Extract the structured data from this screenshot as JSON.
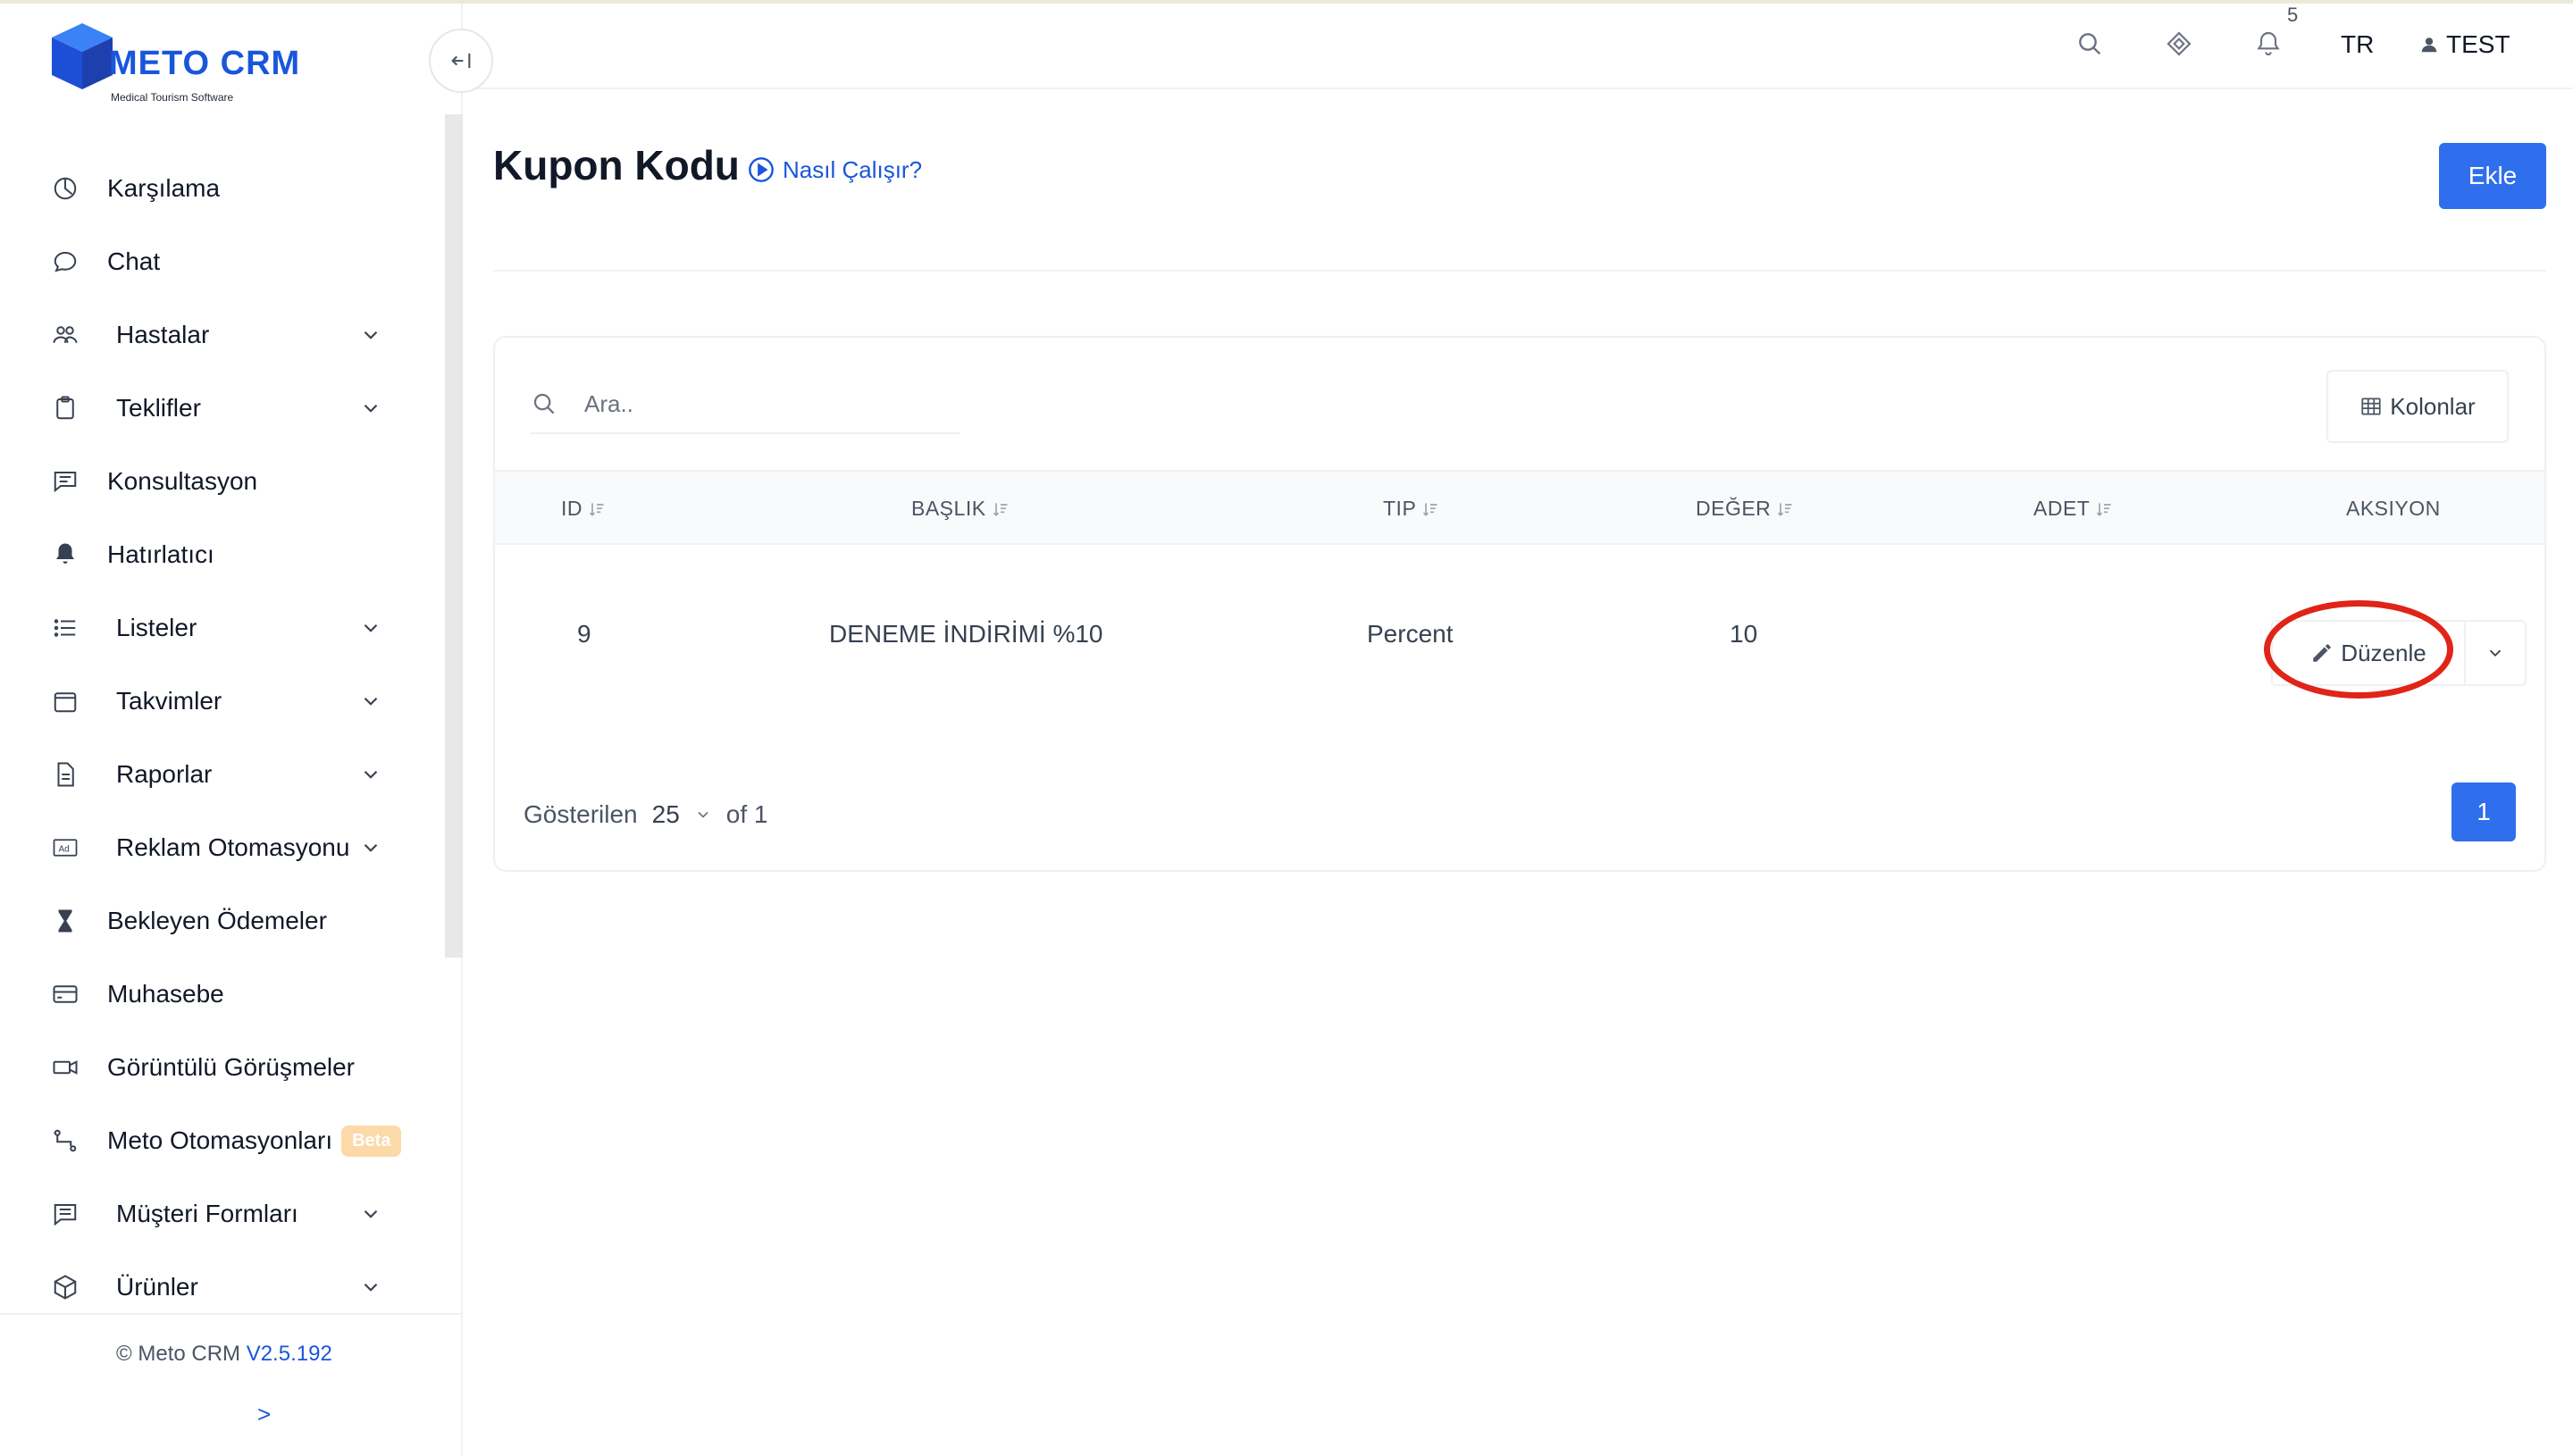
{
  "app": {
    "logo_text": "METO CRM",
    "logo_sub": "Medical Tourism Software",
    "brand_color": "#1a56db",
    "accent_color": "#2f6fed",
    "highlight_color": "#e02418"
  },
  "sidebar": {
    "items": [
      {
        "label": "Karşılama",
        "icon": "dashboard-icon",
        "has_children": false
      },
      {
        "label": "Chat",
        "icon": "chat-bubble-icon",
        "has_children": false
      },
      {
        "label": "Hastalar",
        "icon": "users-icon",
        "has_children": true
      },
      {
        "label": "Teklifler",
        "icon": "clipboard-icon",
        "has_children": true
      },
      {
        "label": "Konsultasyon",
        "icon": "message-square-icon",
        "has_children": false
      },
      {
        "label": "Hatırlatıcı",
        "icon": "bell-icon",
        "has_children": false
      },
      {
        "label": "Listeler",
        "icon": "list-icon",
        "has_children": true
      },
      {
        "label": "Takvimler",
        "icon": "calendar-icon",
        "has_children": true
      },
      {
        "label": "Raporlar",
        "icon": "file-report-icon",
        "has_children": true
      },
      {
        "label": "Reklam Otomasyonu",
        "icon": "ad-icon",
        "has_children": true
      },
      {
        "label": "Bekleyen Ödemeler",
        "icon": "hourglass-icon",
        "has_children": false
      },
      {
        "label": "Muhasebe",
        "icon": "credit-card-icon",
        "has_children": false
      },
      {
        "label": "Görüntülü Görüşmeler",
        "icon": "video-icon",
        "has_children": false
      },
      {
        "label": "Meto Otomasyonları",
        "icon": "flow-icon",
        "has_children": false,
        "badge": "Beta"
      },
      {
        "label": "Müşteri Formları",
        "icon": "form-icon",
        "has_children": true
      },
      {
        "label": "Ürünler",
        "icon": "box-icon",
        "has_children": true
      }
    ],
    "copyright": "© Meto CRM",
    "version": "V2.5.192",
    "expand_label": ">"
  },
  "topbar": {
    "notification_count": "5",
    "language": "TR",
    "user": "TEST"
  },
  "page": {
    "title": "Kupon Kodu",
    "howto_label": "Nasıl Çalışır?",
    "add_label": "Ekle"
  },
  "table": {
    "search_placeholder": "Ara..",
    "columns_button": "Kolonlar",
    "headers": [
      "ID",
      "BAŞLIK",
      "TIP",
      "DEĞER",
      "ADET",
      "AKSIYON"
    ],
    "rows": [
      {
        "id": "9",
        "title": "DENEME İNDİRİMİ %10",
        "type": "Percent",
        "value": "10",
        "count": ""
      }
    ],
    "edit_label": "Düzenle",
    "pager": {
      "shown_label": "Gösterilen",
      "page_size": "25",
      "of_label": "of 1",
      "current_page": "1"
    }
  }
}
